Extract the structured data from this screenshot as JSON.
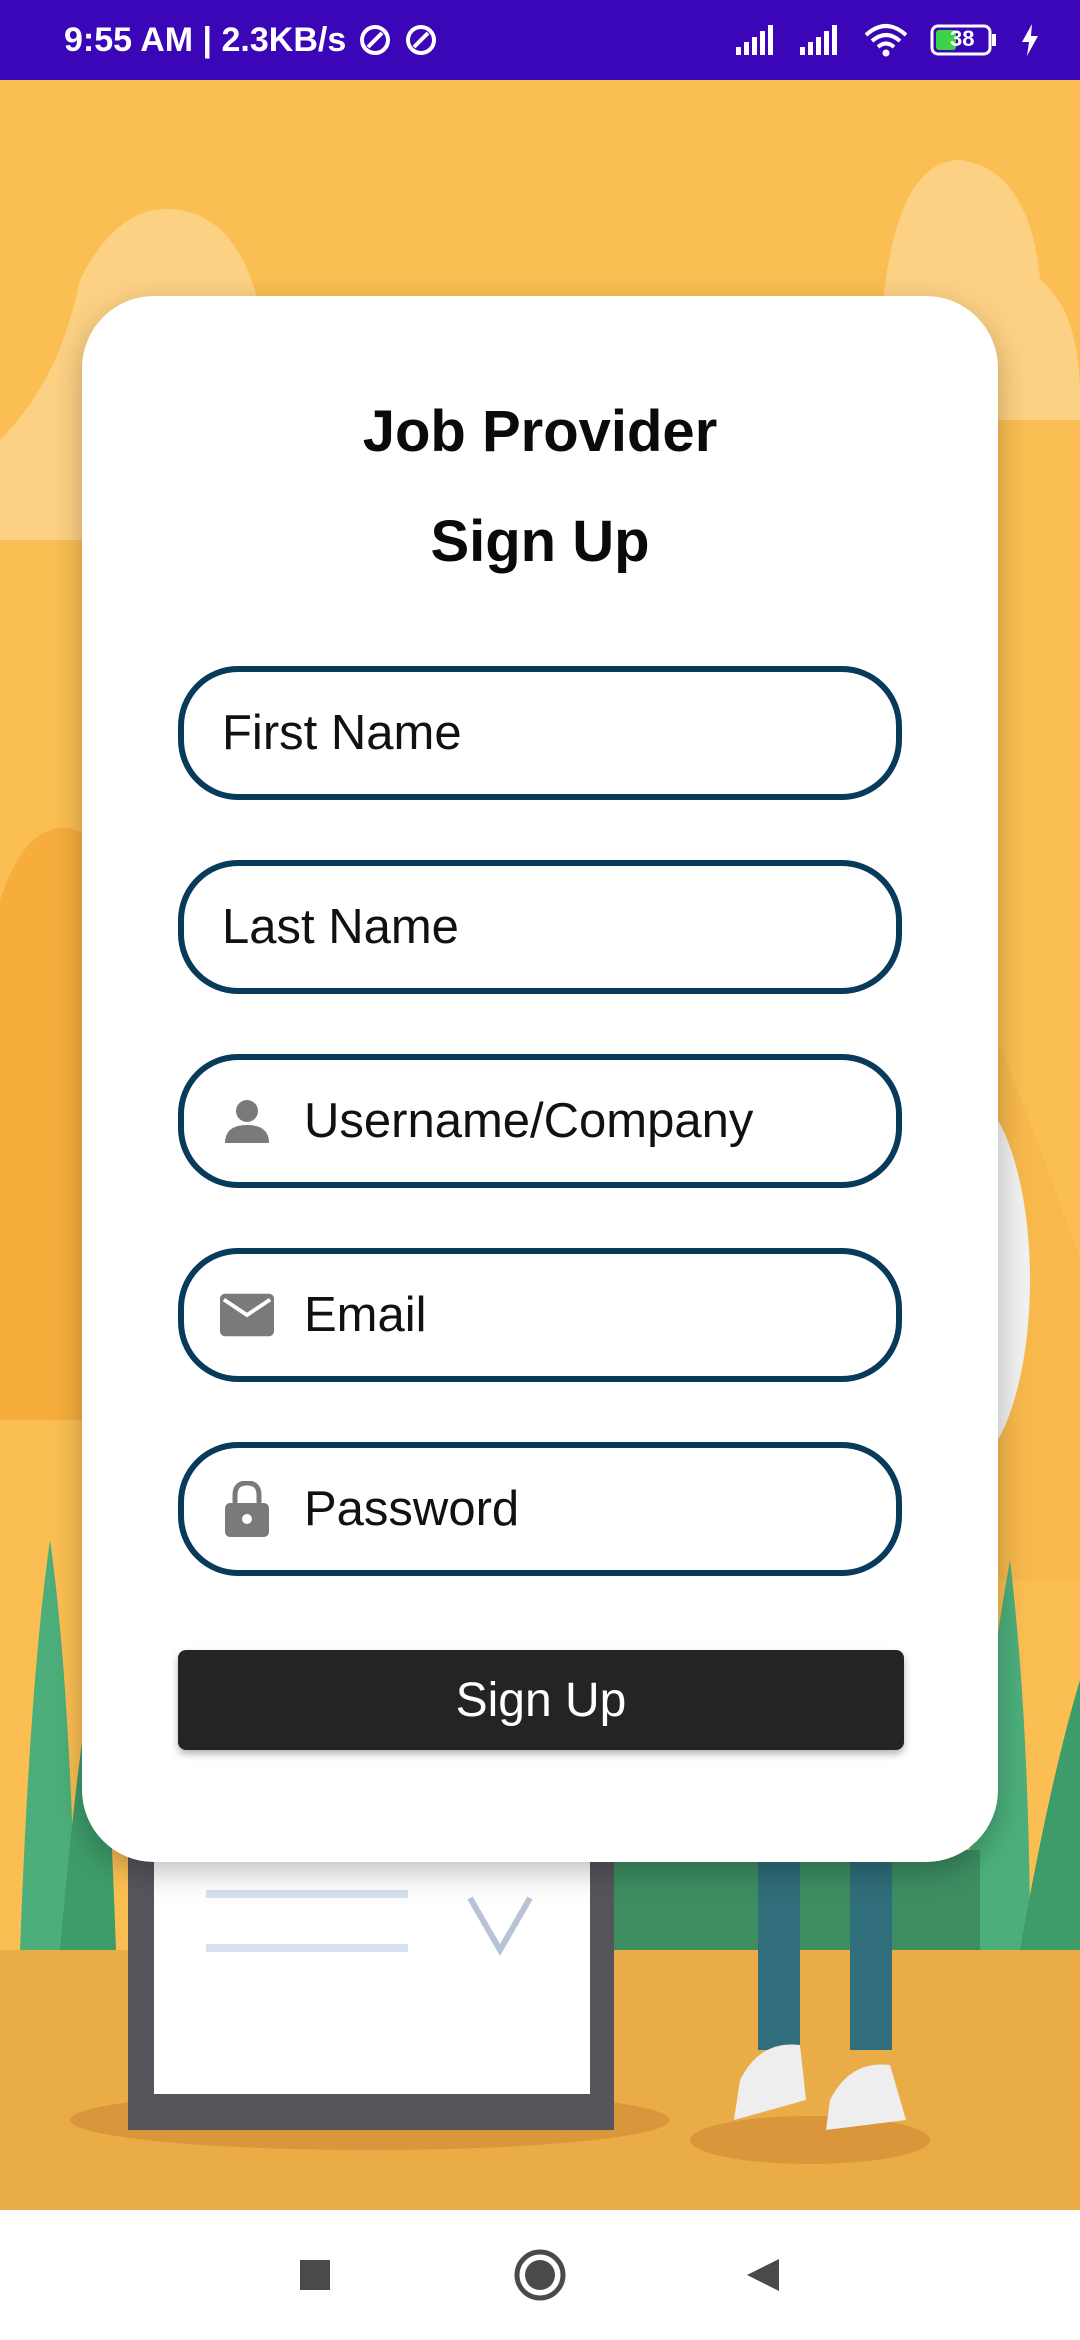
{
  "status_bar": {
    "time_speed": "9:55 AM | 2.3KB/s",
    "battery": "38"
  },
  "card": {
    "title_line1": "Job Provider",
    "title_line2": "Sign Up"
  },
  "form": {
    "first_name_placeholder": "First Name",
    "last_name_placeholder": "Last Name",
    "username_placeholder": "Username/Company",
    "email_placeholder": "Email",
    "password_placeholder": "Password",
    "submit_label": "Sign Up"
  },
  "icons": {
    "username": "person-icon",
    "email": "mail-icon",
    "password": "lock-icon",
    "nav_recents": "square-icon",
    "nav_home": "circle-icon",
    "nav_back": "triangle-back-icon"
  },
  "colors": {
    "status_bar": "#3a06b8",
    "background": "#fbbe52",
    "field_border": "#083a5c",
    "button": "#242424"
  }
}
